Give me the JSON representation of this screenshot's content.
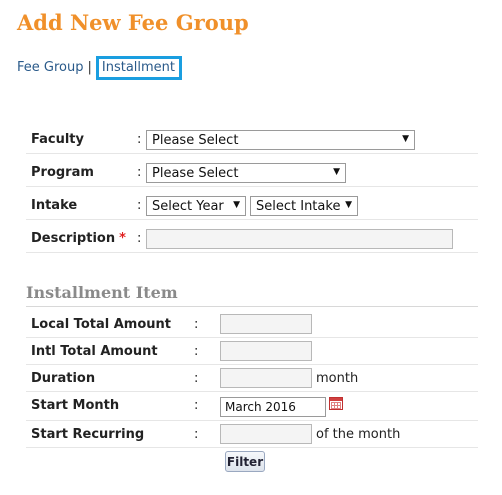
{
  "page": {
    "title": "Add New Fee Group"
  },
  "breadcrumb": {
    "fee_group": "Fee Group",
    "separator": "|",
    "installment": "Installment"
  },
  "form": {
    "faculty": {
      "label": "Faculty",
      "colon": ":",
      "value": "Please Select"
    },
    "program": {
      "label": "Program",
      "colon": ":",
      "value": "Please Select"
    },
    "intake": {
      "label": "Intake",
      "colon": ":",
      "year_value": "Select Year",
      "intake_value": "Select Intake"
    },
    "description": {
      "label": "Description",
      "required_mark": "*",
      "colon": ":",
      "value": ""
    }
  },
  "installment": {
    "section_title": "Installment Item",
    "local_total": {
      "label": "Local Total Amount",
      "colon": ":",
      "value": ""
    },
    "intl_total": {
      "label": "Intl Total Amount",
      "colon": ":",
      "value": ""
    },
    "duration": {
      "label": "Duration",
      "colon": ":",
      "value": "",
      "suffix": "month"
    },
    "start_month": {
      "label": "Start Month",
      "colon": ":",
      "value": "March 2016"
    },
    "start_recurring": {
      "label": "Start Recurring",
      "colon": ":",
      "value": "",
      "suffix": "of the month"
    },
    "filter_label": "Filter"
  },
  "icons": {
    "dropdown": "chevron-down-icon",
    "calendar": "calendar-icon"
  },
  "colors": {
    "title": "#f0902a",
    "link": "#2a5a8a",
    "active_tab_border": "#1a9ee0",
    "required": "#e02020"
  }
}
